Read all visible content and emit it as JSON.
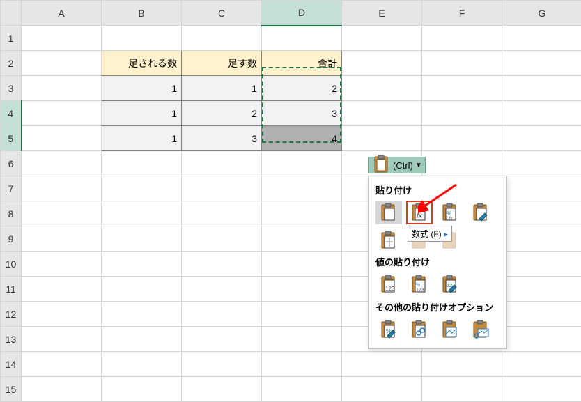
{
  "columns": [
    "A",
    "B",
    "C",
    "D",
    "E",
    "F",
    "G"
  ],
  "rows": [
    "1",
    "2",
    "3",
    "4",
    "5",
    "6",
    "7",
    "8",
    "9",
    "10",
    "11",
    "12",
    "13",
    "14",
    "15"
  ],
  "active_column": "D",
  "selected_rows": [
    "4",
    "5"
  ],
  "table_headers": {
    "b2": "足される数",
    "c2": "足す数",
    "d2": "合計"
  },
  "chart_data": {
    "type": "table",
    "columns": [
      "足される数",
      "足す数",
      "合計"
    ],
    "rows": [
      {
        "足される数": 1,
        "足す数": 1,
        "合計": 2
      },
      {
        "足される数": 1,
        "足す数": 2,
        "合計": 3
      },
      {
        "足される数": 1,
        "足す数": 3,
        "合計": 4
      }
    ]
  },
  "cells": {
    "b3": "1",
    "c3": "1",
    "d3": "2",
    "b4": "1",
    "c4": "2",
    "d4": "3",
    "b5": "1",
    "c5": "3",
    "d5": "4"
  },
  "paste_button_label": "(Ctrl)",
  "paste_menu": {
    "section1": "貼り付け",
    "section2": "値の貼り付け",
    "section3": "その他の貼り付けオプション",
    "tooltip_fx": "数式 (F)",
    "icons": {
      "paste_all": "paste-all-icon",
      "paste_formulas": "paste-formulas-icon",
      "paste_formulas_numfmt": "paste-formulas-numfmt-icon",
      "paste_keep_formatting": "paste-source-format-icon",
      "paste_no_borders": "paste-no-borders-icon",
      "values": "paste-values-icon",
      "values_numfmt": "paste-values-numfmt-icon",
      "values_sourcefmt": "paste-values-sourcefmt-icon",
      "other_formatting": "paste-formatting-icon",
      "other_link": "paste-link-icon",
      "other_picture": "paste-picture-icon",
      "other_linked_picture": "paste-linked-picture-icon"
    }
  }
}
